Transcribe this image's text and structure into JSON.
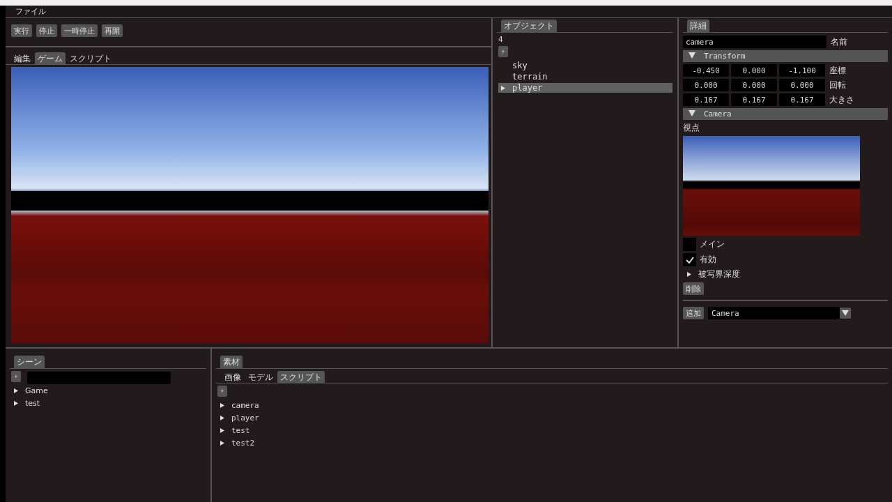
{
  "menu": [
    "ファイル"
  ],
  "toolbar": [
    "実行",
    "停止",
    "一時停止",
    "再開"
  ],
  "view_tabs": [
    {
      "label": "編集",
      "selected": false
    },
    {
      "label": "ゲーム",
      "selected": true
    },
    {
      "label": "スクリプト",
      "selected": false
    }
  ],
  "objects": {
    "title": "オブジェクト",
    "count": "4",
    "add": "+",
    "items": [
      {
        "label": "sky",
        "kind": "leaf",
        "selected": false
      },
      {
        "label": "terrain",
        "kind": "leaf",
        "selected": false
      },
      {
        "label": "player",
        "kind": "group",
        "selected": true
      }
    ]
  },
  "details": {
    "title": "詳細",
    "name_value": "camera",
    "name_label": "名前",
    "transform": {
      "title": "Transform",
      "expanded": true,
      "rows": [
        {
          "label": "座標",
          "values": [
            "-0.450",
            "0.000",
            "-1.100"
          ]
        },
        {
          "label": "回転",
          "values": [
            "0.000",
            "0.000",
            "0.000"
          ]
        },
        {
          "label": "大きさ",
          "values": [
            "0.167",
            "0.167",
            "0.167"
          ]
        }
      ]
    },
    "camera": {
      "title": "Camera",
      "expanded": true,
      "view_label": "視点",
      "checks": [
        {
          "label": "メイン",
          "checked": false
        },
        {
          "label": "有効",
          "checked": true
        }
      ],
      "dof": {
        "label": "被写界深度",
        "expanded": false
      },
      "delete": "削除"
    },
    "add_button": "追加",
    "add_select": "Camera"
  },
  "scenes": {
    "title": "シーン",
    "add": "+",
    "items": [
      {
        "label": "Game"
      },
      {
        "label": "test"
      }
    ]
  },
  "assets": {
    "title": "素材",
    "tabs": [
      {
        "label": "画像",
        "selected": false
      },
      {
        "label": "モデル",
        "selected": false
      },
      {
        "label": "スクリプト",
        "selected": true
      }
    ],
    "add": "+",
    "items": [
      {
        "label": "camera"
      },
      {
        "label": "player"
      },
      {
        "label": "test"
      },
      {
        "label": "test2"
      }
    ]
  }
}
